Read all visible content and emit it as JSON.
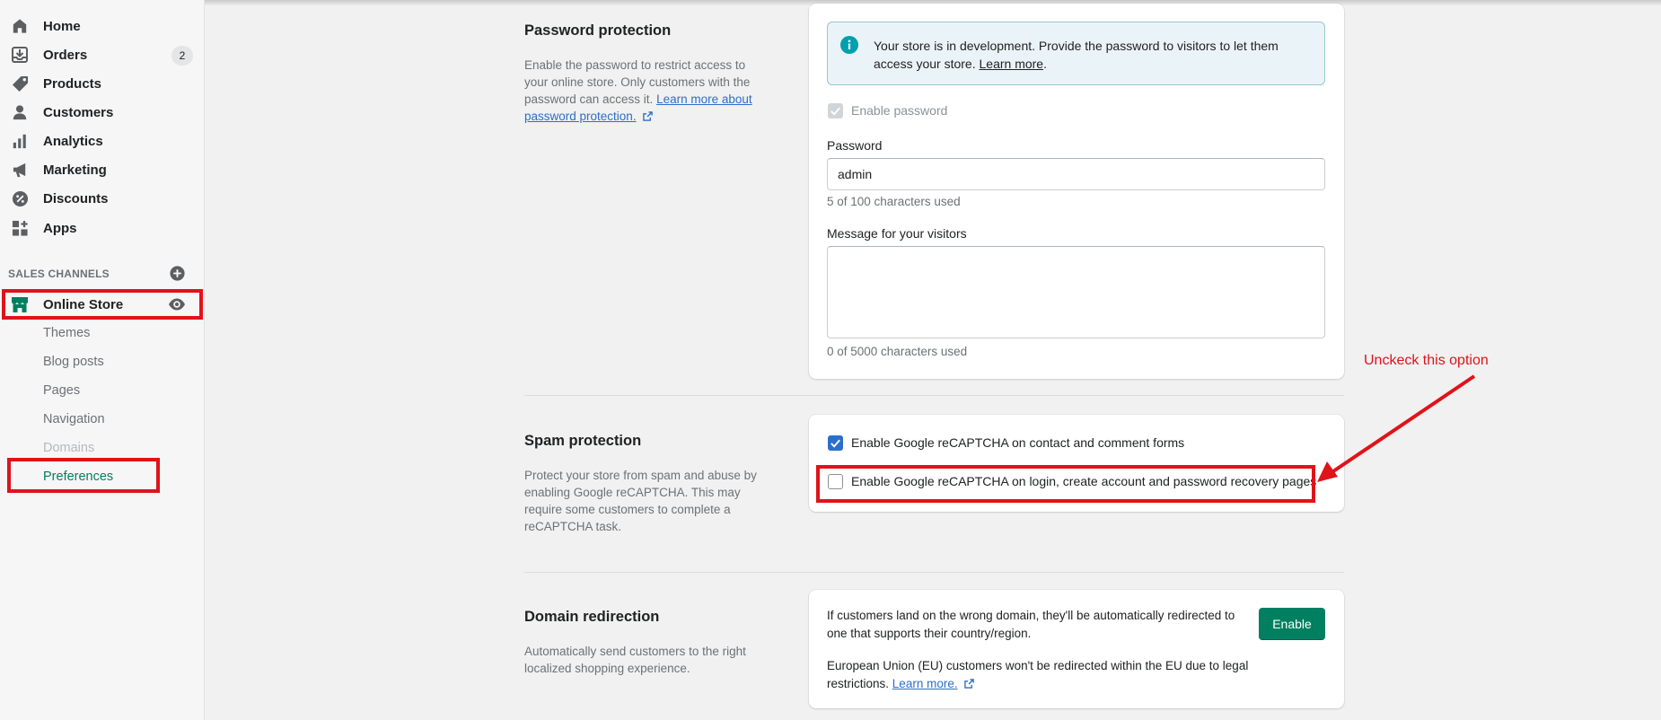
{
  "sidebar": {
    "items": [
      {
        "label": "Home",
        "icon": "home-icon"
      },
      {
        "label": "Orders",
        "icon": "orders-icon",
        "badge": "2"
      },
      {
        "label": "Products",
        "icon": "tag-icon"
      },
      {
        "label": "Customers",
        "icon": "person-icon"
      },
      {
        "label": "Analytics",
        "icon": "bar-chart-icon"
      },
      {
        "label": "Marketing",
        "icon": "megaphone-icon"
      },
      {
        "label": "Discounts",
        "icon": "discount-icon"
      },
      {
        "label": "Apps",
        "icon": "apps-icon"
      }
    ],
    "sales_channels_heading": "SALES CHANNELS",
    "online_store": {
      "label": "Online Store"
    },
    "sub_items": [
      "Themes",
      "Blog posts",
      "Pages",
      "Navigation",
      "Domains",
      "Preferences"
    ]
  },
  "password_protection": {
    "title": "Password protection",
    "description": "Enable the password to restrict access to your online store. Only customers with the password can access it.",
    "learn_more_link": "Learn more about password protection.",
    "banner_text": "Your store is in development. Provide the password to visitors to let them access your store.",
    "banner_link": "Learn more",
    "enable_password_label": "Enable password",
    "password_label": "Password",
    "password_value": "admin",
    "password_help": "5 of 100 characters used",
    "message_label": "Message for your visitors",
    "message_value": "",
    "message_help": "0 of 5000 characters used"
  },
  "spam_protection": {
    "title": "Spam protection",
    "description": "Protect your store from spam and abuse by enabling Google reCAPTCHA. This may require some customers to complete a reCAPTCHA task.",
    "option1_label": "Enable Google reCAPTCHA on contact and comment forms",
    "option1_checked": true,
    "option2_label": "Enable Google reCAPTCHA on login, create account and password recovery pages",
    "option2_checked": false
  },
  "domain_redirection": {
    "title": "Domain redirection",
    "description": "Automatically send customers to the right localized shopping experience.",
    "text1": "If customers land on the wrong domain, they'll be automatically redirected to one that supports their country/region.",
    "text2": "European Union (EU) customers won't be redirected within the EU due to legal restrictions.",
    "learn_more": "Learn more.",
    "button_label": "Enable"
  },
  "annotation": {
    "text": "Unckeck this option",
    "color": "#e0131a"
  },
  "colors": {
    "accent_green": "#008060",
    "checkbox_blue": "#2c6ecb",
    "link_blue": "#2c6ecb"
  }
}
